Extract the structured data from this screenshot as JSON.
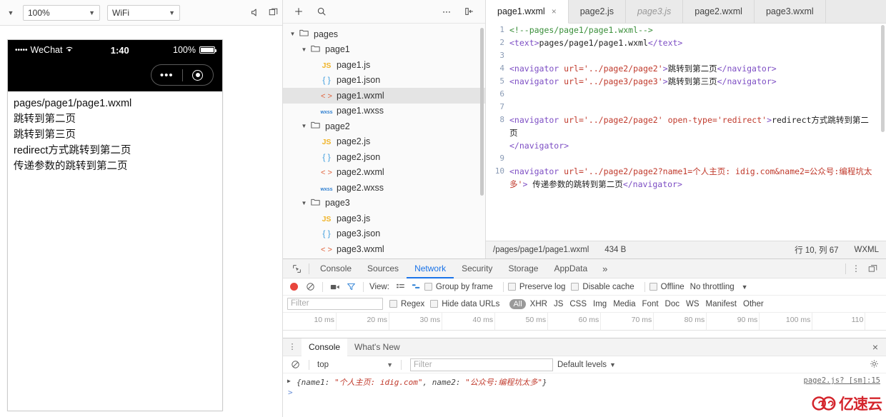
{
  "simulator": {
    "toolbar": {
      "zoom": "100%",
      "network": "WiFi",
      "mute_icon": "mute-icon",
      "layout_icon": "panel-layout-icon"
    },
    "status": {
      "carrier_dots": "•••••",
      "carrier": "WeChat",
      "wifi_icon": "wifi-icon",
      "time": "1:40",
      "battery": "100%"
    },
    "capsule": {
      "dots": "•••",
      "circle_icon": "target-circle-icon"
    },
    "page_lines": [
      "pages/page1/page1.wxml",
      "跳转到第二页",
      "跳转到第三页",
      "redirect方式跳转到第二页",
      "传递参数的跳转到第二页"
    ]
  },
  "tree": {
    "toolbar": {
      "add_icon": "plus-icon",
      "search_icon": "search-icon",
      "more_icon": "ellipsis-icon",
      "collapse_icon": "collapse-panel-icon"
    },
    "rows": [
      {
        "label": "pages",
        "icon": "folder-icon",
        "indent": 0,
        "caret": "▼",
        "selected": false
      },
      {
        "label": "page1",
        "icon": "folder-icon",
        "indent": 1,
        "caret": "▼",
        "selected": false
      },
      {
        "label": "page1.js",
        "icon": "js-icon",
        "indent": 2,
        "caret": "",
        "selected": false
      },
      {
        "label": "page1.json",
        "icon": "json-icon",
        "indent": 2,
        "caret": "",
        "selected": false
      },
      {
        "label": "page1.wxml",
        "icon": "wxml-icon",
        "indent": 2,
        "caret": "",
        "selected": true
      },
      {
        "label": "page1.wxss",
        "icon": "wxss-icon",
        "indent": 2,
        "caret": "",
        "selected": false
      },
      {
        "label": "page2",
        "icon": "folder-icon",
        "indent": 1,
        "caret": "▼",
        "selected": false
      },
      {
        "label": "page2.js",
        "icon": "js-icon",
        "indent": 2,
        "caret": "",
        "selected": false
      },
      {
        "label": "page2.json",
        "icon": "json-icon",
        "indent": 2,
        "caret": "",
        "selected": false
      },
      {
        "label": "page2.wxml",
        "icon": "wxml-icon",
        "indent": 2,
        "caret": "",
        "selected": false
      },
      {
        "label": "page2.wxss",
        "icon": "wxss-icon",
        "indent": 2,
        "caret": "",
        "selected": false
      },
      {
        "label": "page3",
        "icon": "folder-icon",
        "indent": 1,
        "caret": "▼",
        "selected": false
      },
      {
        "label": "page3.js",
        "icon": "js-icon",
        "indent": 2,
        "caret": "",
        "selected": false
      },
      {
        "label": "page3.json",
        "icon": "json-icon",
        "indent": 2,
        "caret": "",
        "selected": false
      },
      {
        "label": "page3.wxml",
        "icon": "wxml-icon",
        "indent": 2,
        "caret": "",
        "selected": false
      }
    ]
  },
  "editor": {
    "tabs": [
      {
        "label": "page1.wxml",
        "active": true,
        "italic": false,
        "close": "×"
      },
      {
        "label": "page2.js",
        "active": false,
        "italic": false,
        "close": ""
      },
      {
        "label": "page3.js",
        "active": false,
        "italic": true,
        "close": ""
      },
      {
        "label": "page2.wxml",
        "active": false,
        "italic": false,
        "close": ""
      },
      {
        "label": "page3.wxml",
        "active": false,
        "italic": false,
        "close": ""
      }
    ],
    "lines": [
      {
        "n": "1",
        "parts": [
          {
            "t": "<!--pages/page1/page1.wxml-->",
            "c": "k-com"
          }
        ]
      },
      {
        "n": "2",
        "parts": [
          {
            "t": "<text>",
            "c": "k-tag"
          },
          {
            "t": "pages/page1/page1.wxml",
            "c": "k-txt"
          },
          {
            "t": "</text>",
            "c": "k-tag"
          }
        ]
      },
      {
        "n": "3",
        "parts": []
      },
      {
        "n": "4",
        "parts": [
          {
            "t": "<navigator ",
            "c": "k-tag"
          },
          {
            "t": "url=",
            "c": "k-attr"
          },
          {
            "t": "'../page2/page2'",
            "c": "k-str"
          },
          {
            "t": ">",
            "c": "k-tag"
          },
          {
            "t": "跳转到第二页",
            "c": "k-txt"
          },
          {
            "t": "</navigator>",
            "c": "k-tag"
          }
        ]
      },
      {
        "n": "5",
        "parts": [
          {
            "t": "<navigator ",
            "c": "k-tag"
          },
          {
            "t": "url=",
            "c": "k-attr"
          },
          {
            "t": "'../page3/page3'",
            "c": "k-str"
          },
          {
            "t": ">",
            "c": "k-tag"
          },
          {
            "t": "跳转到第三页",
            "c": "k-txt"
          },
          {
            "t": "</navigator>",
            "c": "k-tag"
          }
        ]
      },
      {
        "n": "6",
        "parts": []
      },
      {
        "n": "7",
        "parts": []
      },
      {
        "n": "8",
        "parts": [
          {
            "t": "<navigator ",
            "c": "k-tag"
          },
          {
            "t": "url=",
            "c": "k-attr"
          },
          {
            "t": "'../page2/page2'",
            "c": "k-str"
          },
          {
            "t": " ",
            "c": "k-txt"
          },
          {
            "t": "open-type=",
            "c": "k-attr"
          },
          {
            "t": "'redirect'",
            "c": "k-str"
          },
          {
            "t": ">",
            "c": "k-tag"
          },
          {
            "t": "redirect方式跳转到第二页\n",
            "c": "k-txt"
          },
          {
            "t": "</navigator>",
            "c": "k-tag"
          }
        ]
      },
      {
        "n": "9",
        "parts": []
      },
      {
        "n": "10",
        "parts": [
          {
            "t": "<navigator ",
            "c": "k-tag"
          },
          {
            "t": "url=",
            "c": "k-attr"
          },
          {
            "t": "'../page2/page2?name1=个人主页: idig.com&name2=公众号:编程坑太多'",
            "c": "k-str"
          },
          {
            "t": ">",
            "c": "k-tag"
          },
          {
            "t": " 传递参数的跳转到第二页",
            "c": "k-txt"
          },
          {
            "t": "</navigator>",
            "c": "k-tag"
          }
        ]
      }
    ],
    "status": {
      "path": "/pages/page1/page1.wxml",
      "size": "434 B",
      "cursor": "行 10, 列 67",
      "language": "WXML"
    }
  },
  "devtools": {
    "tabs": [
      {
        "label": "Console",
        "active": false
      },
      {
        "label": "Sources",
        "active": false
      },
      {
        "label": "Network",
        "active": true
      },
      {
        "label": "Security",
        "active": false
      },
      {
        "label": "Storage",
        "active": false
      },
      {
        "label": "AppData",
        "active": false
      }
    ],
    "more": "»",
    "inspect_icon": "inspect-element-icon",
    "kebab_icon": "kebab-menu-icon",
    "dock_icon": "dock-position-icon",
    "network_toolbar": {
      "record_icon": "record-button",
      "clear_icon": "clear-icon",
      "camera_icon": "screenshot-camera-icon",
      "filter_icon": "filter-funnel-icon",
      "view_label": "View:",
      "list_icon": "list-view-icon",
      "waterfall_icon": "waterfall-view-icon",
      "group_by_frame": "Group by frame",
      "preserve_log": "Preserve log",
      "disable_cache": "Disable cache",
      "offline": "Offline",
      "throttling": "No throttling",
      "throttling_caret": "▼"
    },
    "filter_bar": {
      "filter_placeholder": "Filter",
      "regex": "Regex",
      "hide_data_urls": "Hide data URLs",
      "types": [
        "All",
        "XHR",
        "JS",
        "CSS",
        "Img",
        "Media",
        "Font",
        "Doc",
        "WS",
        "Manifest",
        "Other"
      ],
      "active_type": "All"
    },
    "ruler_ticks": [
      "10 ms",
      "20 ms",
      "30 ms",
      "40 ms",
      "50 ms",
      "60 ms",
      "70 ms",
      "80 ms",
      "90 ms",
      "100 ms",
      "110"
    ]
  },
  "drawer": {
    "kebab_icon": "kebab-menu-icon",
    "tabs": [
      {
        "label": "Console",
        "active": true
      },
      {
        "label": "What's New",
        "active": false
      }
    ],
    "close": "×",
    "toolbar": {
      "clear_icon": "clear-console-icon",
      "context": "top",
      "context_caret": "▼",
      "filter_placeholder": "Filter",
      "levels": "Default levels",
      "levels_caret": "▼",
      "gear_icon": "settings-gear-icon"
    },
    "log": {
      "expander": "▶",
      "pre": "{name1: ",
      "v1": "\"个人主页: idig.com\"",
      "mid": ", name2: ",
      "v2": "\"公众号:编程坑太多\"",
      "post": "}",
      "source": "page2.js? [sm]:15",
      "prompt": ">"
    }
  },
  "watermark": {
    "text": "亿速云",
    "icon": "cloud-logo-icon",
    "color": "#d4252c"
  }
}
